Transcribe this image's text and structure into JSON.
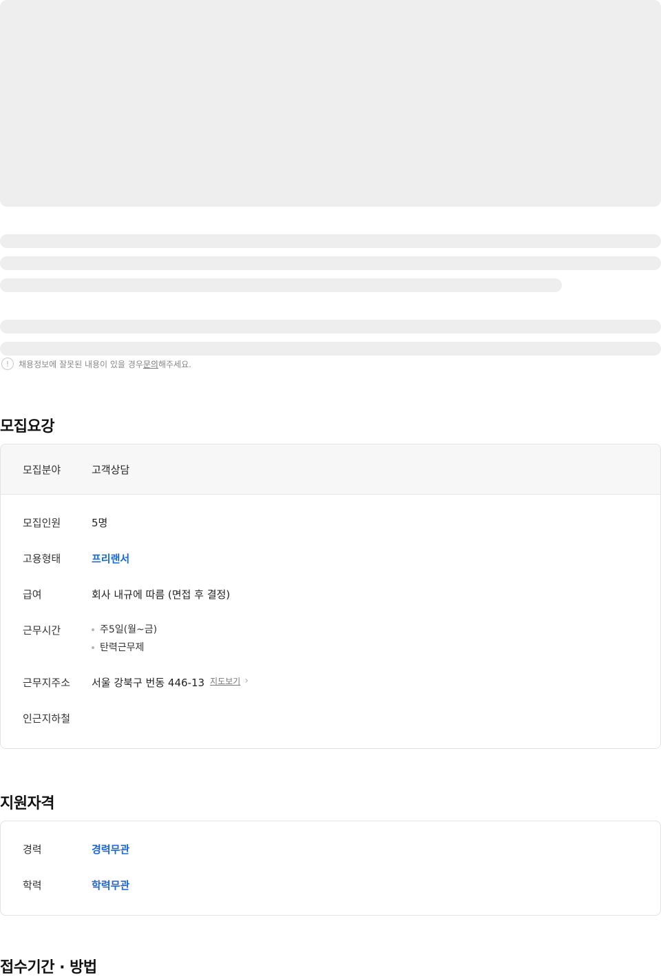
{
  "notice": {
    "text_before": "채용정보에 잘못된 내용이 있을 경우 ",
    "link": "문의",
    "text_after": "해주세요.",
    "icon": "exclamation-circle-icon"
  },
  "recruitment": {
    "title": "모집요강",
    "field_label": "모집분야",
    "field_value": "고객상담",
    "rows": {
      "headcount_label": "모집인원",
      "headcount_value": "5명",
      "employment_label": "고용형태",
      "employment_value": "프리랜서",
      "salary_label": "급여",
      "salary_value": "회사 내규에 따름 (면접 후 결정)",
      "hours_label": "근무시간",
      "hours_items": [
        "주5일(월~금)",
        "탄력근무제"
      ],
      "address_label": "근무지주소",
      "address_value": "서울 강북구 번동 446-13",
      "map_link": "지도보기",
      "subway_label": "인근지하철"
    }
  },
  "qualifications": {
    "title": "지원자격",
    "experience_label": "경력",
    "experience_value": "경력무관",
    "education_label": "학력",
    "education_value": "학력무관"
  },
  "application": {
    "title": "접수기간 · 방법"
  },
  "colors": {
    "accent": "#1a66d6",
    "skeleton": "#eeeeee"
  }
}
